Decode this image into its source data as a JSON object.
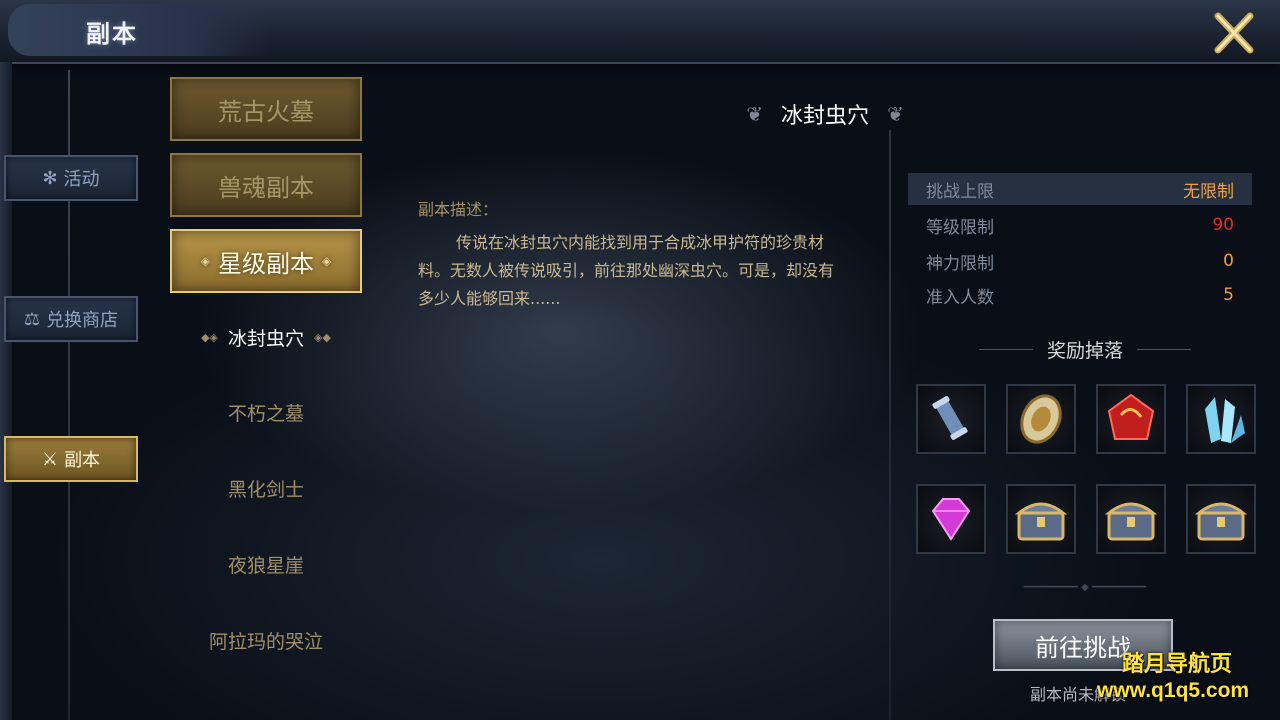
{
  "window": {
    "title": "副本",
    "close_icon": "close-x-icon"
  },
  "nav": [
    {
      "label": "活动",
      "icon": "snowflake-icon",
      "active": false
    },
    {
      "label": "兑换商店",
      "icon": "scales-icon",
      "active": false
    },
    {
      "label": "副本",
      "icon": "crossed-swords-icon",
      "active": true
    }
  ],
  "categories": [
    {
      "label": "荒古火墓",
      "active": false
    },
    {
      "label": "兽魂副本",
      "active": false
    },
    {
      "label": "星级副本",
      "active": true
    }
  ],
  "dungeons": [
    {
      "label": "冰封虫穴",
      "active": true
    },
    {
      "label": "不朽之墓",
      "active": false
    },
    {
      "label": "黑化剑士",
      "active": false
    },
    {
      "label": "夜狼星崖",
      "active": false
    },
    {
      "label": "阿拉玛的哭泣",
      "active": false
    }
  ],
  "detail": {
    "name": "冰封虫穴",
    "desc_label": "副本描述：",
    "desc_text": "传说在冰封虫穴内能找到用于合成冰甲护符的珍贵材料。无数人被传说吸引，前往那处幽深虫穴。可是，却没有多少人能够回来......"
  },
  "stats": [
    {
      "label": "挑战上限",
      "value": "无限制",
      "color": "#f0a040"
    },
    {
      "label": "等级限制",
      "value": "90",
      "color": "#e02a2a"
    },
    {
      "label": "神力限制",
      "value": "0",
      "color": "#f0a040"
    },
    {
      "label": "准入人数",
      "value": "5",
      "color": "#f0a040"
    }
  ],
  "rewards": {
    "title": "奖励掉落",
    "items": [
      {
        "icon": "scroll-icon"
      },
      {
        "icon": "amulet-icon"
      },
      {
        "icon": "red-gem-icon"
      },
      {
        "icon": "ice-crystal-icon"
      },
      {
        "icon": "purple-diamond-icon"
      },
      {
        "icon": "treasure-chest-icon"
      },
      {
        "icon": "treasure-chest-icon"
      },
      {
        "icon": "treasure-chest-icon"
      }
    ]
  },
  "action": {
    "button_label": "前往挑战",
    "status_text": "副本尚未解锁"
  },
  "watermark": {
    "line1": "踏月导航页",
    "line2": "www.q1q5.com"
  }
}
